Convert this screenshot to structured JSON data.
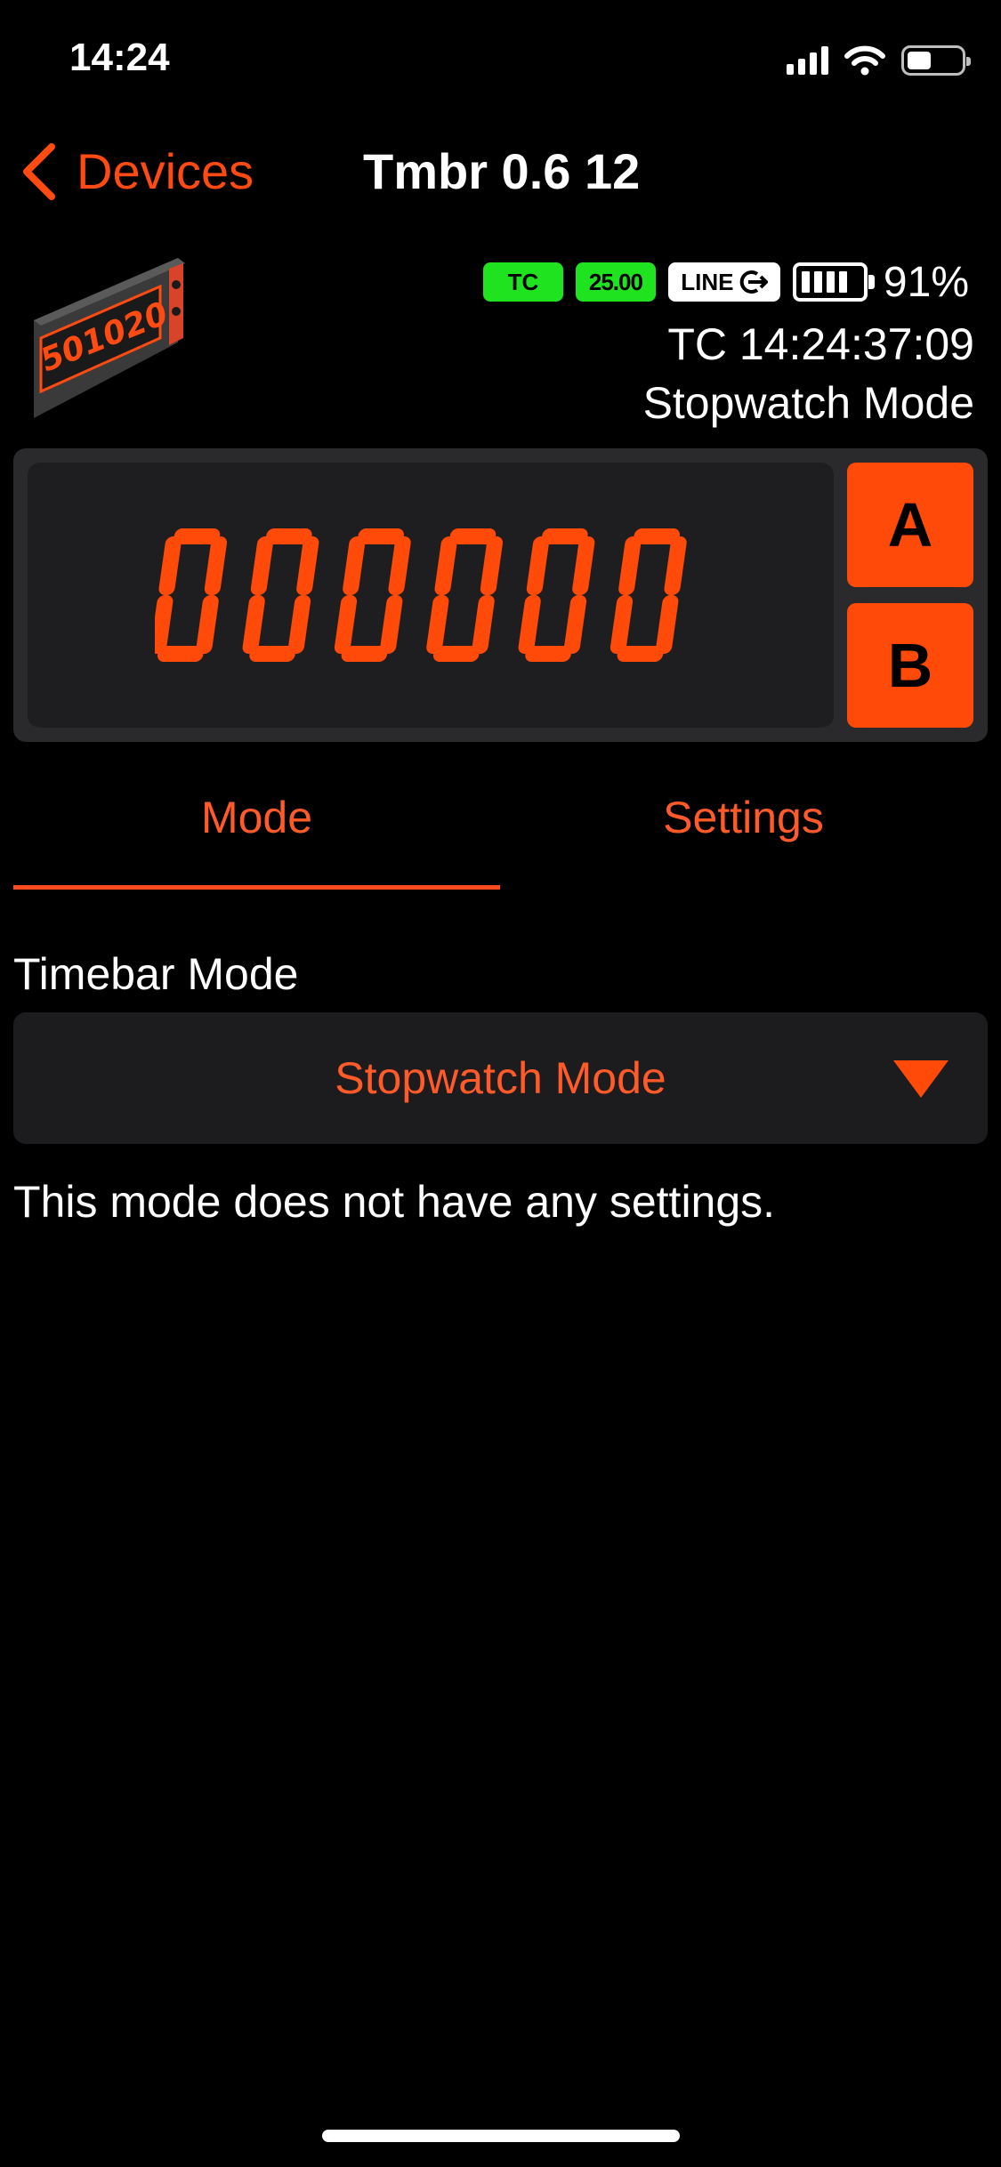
{
  "status_bar": {
    "time": "14:24"
  },
  "nav": {
    "back_label": "Devices",
    "title": "Tmbr 0.6 12"
  },
  "device": {
    "image_text": "501020",
    "badges": {
      "tc": "TC",
      "fps": "25.00",
      "line": "LINE"
    },
    "battery_percent": "91%",
    "timecode": "TC 14:24:37:09",
    "mode": "Stopwatch Mode"
  },
  "display": {
    "digits": "000000",
    "button_a": "A",
    "button_b": "B"
  },
  "tabs": [
    {
      "label": "Mode",
      "active": true
    },
    {
      "label": "Settings",
      "active": false
    }
  ],
  "mode_section": {
    "label": "Timebar Mode",
    "selected": "Stopwatch Mode",
    "info": "This mode does not have any settings."
  },
  "colors": {
    "accent": "#ff4a0a",
    "badge_green": "#1fe31f",
    "panel": "#2a2a2c",
    "background": "#000000"
  }
}
